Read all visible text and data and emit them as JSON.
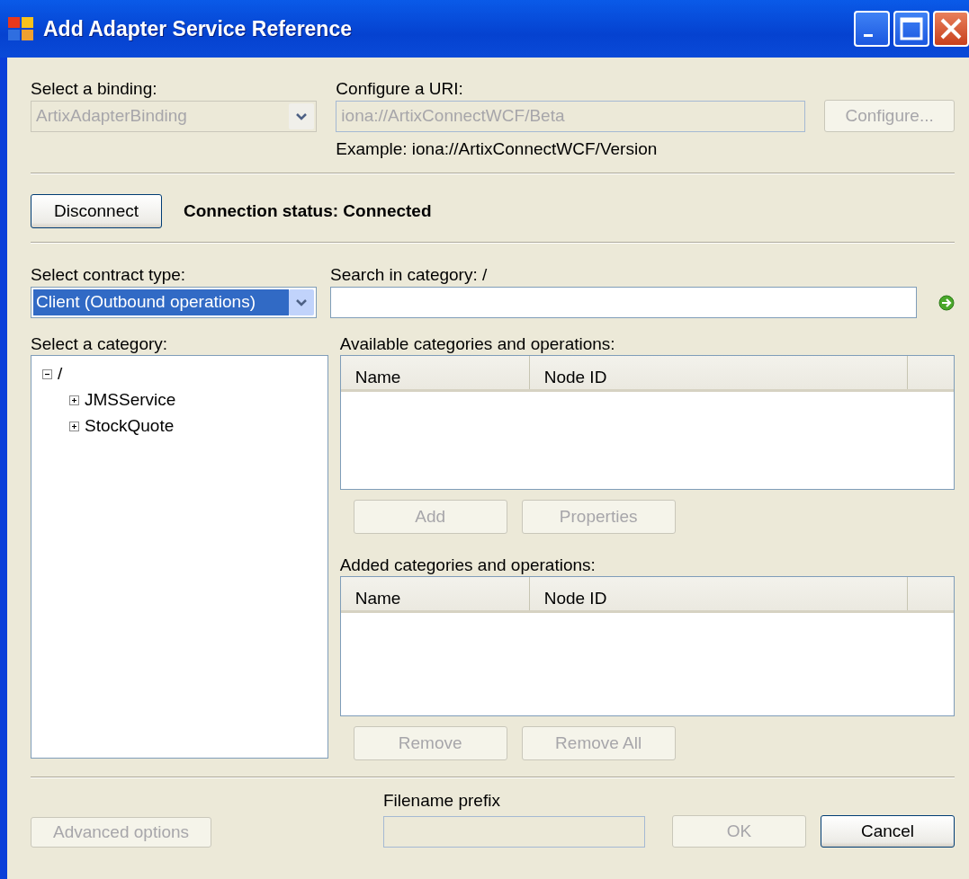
{
  "window": {
    "title": "Add Adapter Service Reference"
  },
  "binding": {
    "label": "Select a binding:",
    "value": "ArtixAdapterBinding",
    "disabled": true
  },
  "uri": {
    "label": "Configure a URI:",
    "value": "iona://ArtixConnectWCF/Beta",
    "disabled": true,
    "example": "Example: iona://ArtixConnectWCF/Version"
  },
  "configure_button": {
    "label": "Configure...",
    "disabled": true
  },
  "connect_button": {
    "label": "Disconnect",
    "disabled": false
  },
  "connection_status": "Connection status: Connected",
  "contract_type": {
    "label": "Select contract type:",
    "value": "Client (Outbound operations)",
    "selected": true
  },
  "search": {
    "label": "Search in category: /"
  },
  "category_tree": {
    "label": "Select a category:",
    "items": [
      {
        "label": "/",
        "expanded": true,
        "children": [
          {
            "label": "JMSService",
            "expanded": false
          },
          {
            "label": "StockQuote",
            "expanded": false
          }
        ]
      }
    ]
  },
  "available": {
    "label": "Available categories and operations:",
    "columns": [
      "Name",
      "Node ID"
    ]
  },
  "available_buttons": [
    {
      "label": "Add",
      "disabled": true
    },
    {
      "label": "Properties",
      "disabled": true
    }
  ],
  "added": {
    "label": "Added categories and operations:",
    "columns": [
      "Name",
      "Node ID"
    ]
  },
  "added_buttons": [
    {
      "label": "Remove",
      "disabled": true
    },
    {
      "label": "Remove All",
      "disabled": true
    }
  ],
  "advanced_button": {
    "label": "Advanced options",
    "disabled": true
  },
  "filename_prefix": {
    "label": "Filename prefix",
    "disabled": true
  },
  "dialog_buttons": [
    {
      "label": "OK",
      "disabled": true
    },
    {
      "label": "Cancel",
      "disabled": false
    }
  ]
}
